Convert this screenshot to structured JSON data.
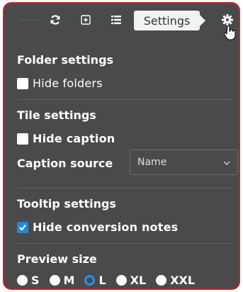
{
  "toolbar": {
    "icons": [
      "refresh-icon",
      "expand-icon",
      "list-view-icon",
      "gear-icon"
    ],
    "tooltip": "Settings"
  },
  "folder_settings": {
    "title": "Folder settings",
    "hide_folders": "Hide folders",
    "hide_folders_checked": false
  },
  "tile_settings": {
    "title": "Tile settings",
    "hide_caption": "Hide caption",
    "hide_caption_checked": false,
    "caption_source_label": "Caption source",
    "caption_source_value": "Name"
  },
  "tooltip_settings": {
    "title": "Tooltip settings",
    "hide_conversion_notes": "Hide conversion notes",
    "hide_conversion_notes_checked": true
  },
  "preview_size": {
    "title": "Preview size",
    "options": [
      "S",
      "M",
      "L",
      "XL",
      "XXL"
    ],
    "selected": "L"
  },
  "colors": {
    "panel_bg": "#4a4a4a",
    "border": "#c4232b",
    "accent": "#2196f3"
  }
}
